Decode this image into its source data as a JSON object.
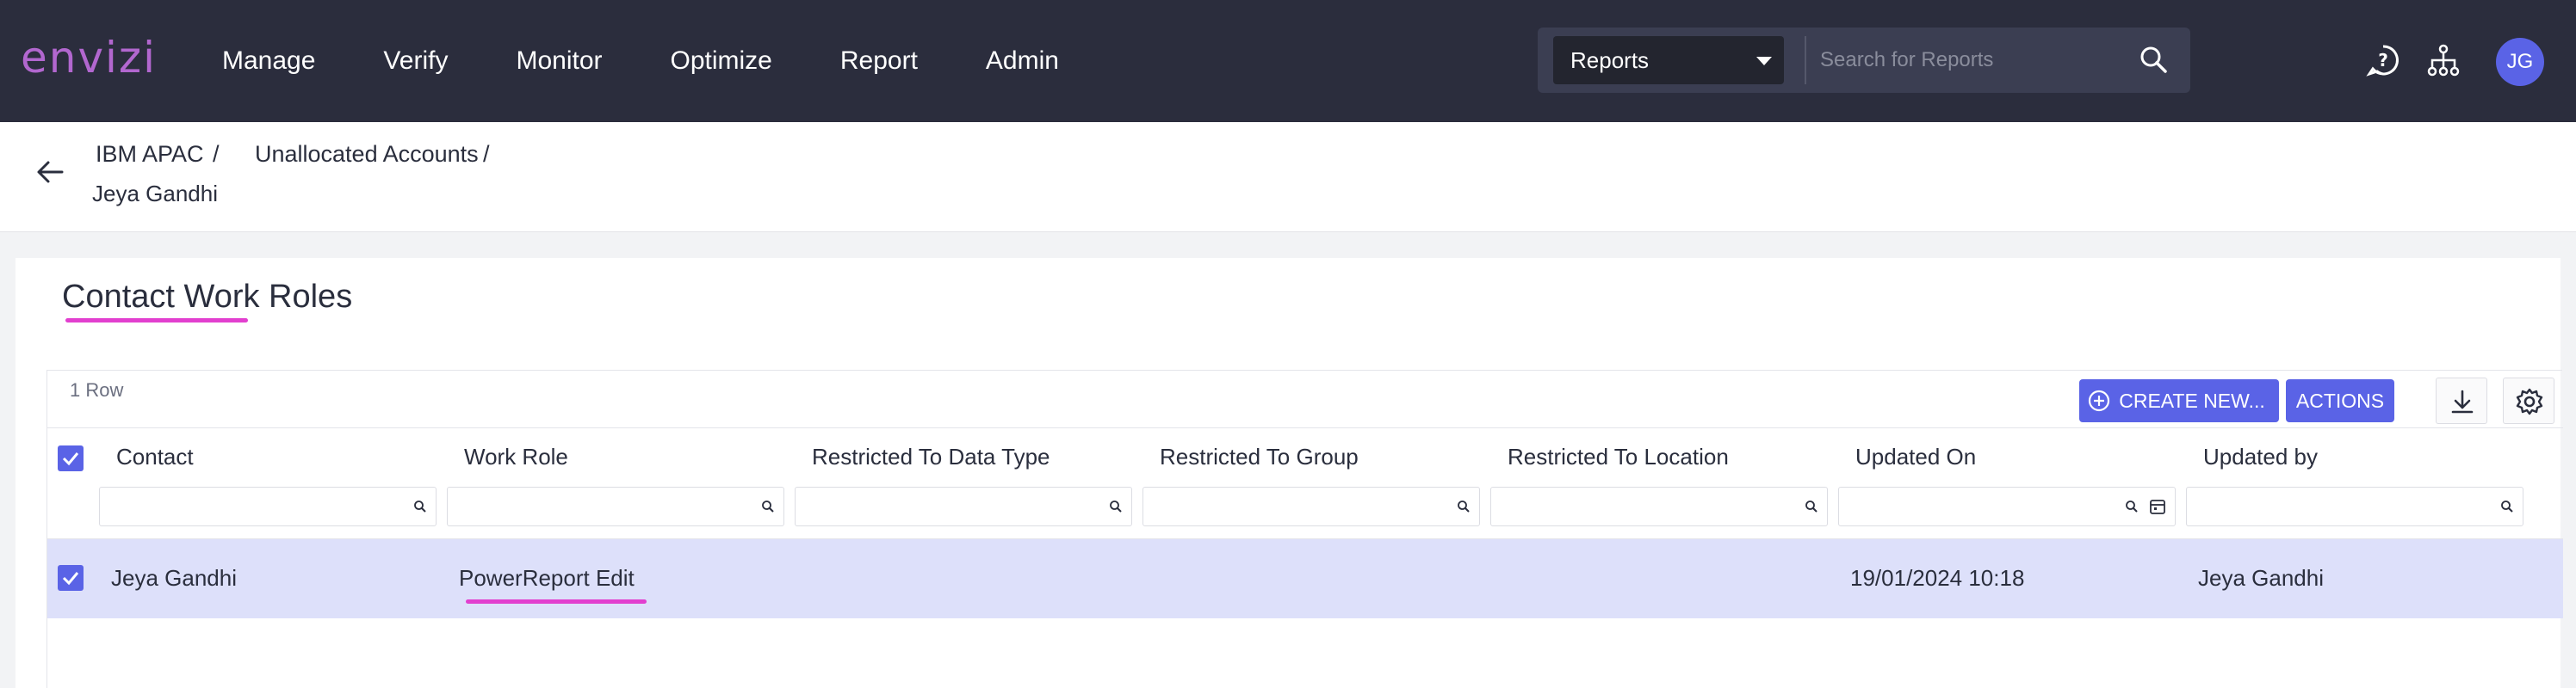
{
  "app": {
    "logo": "envizi"
  },
  "nav": [
    {
      "label": "Manage"
    },
    {
      "label": "Verify"
    },
    {
      "label": "Monitor"
    },
    {
      "label": "Optimize"
    },
    {
      "label": "Report"
    },
    {
      "label": "Admin"
    }
  ],
  "search": {
    "scope": "Reports",
    "placeholder": "Search for Reports"
  },
  "user": {
    "initials": "JG"
  },
  "breadcrumb": {
    "items": [
      "IBM APAC",
      "Unallocated Accounts"
    ],
    "separator": "/",
    "current": "Jeya Gandhi"
  },
  "page": {
    "title": "Contact Work Roles"
  },
  "grid": {
    "row_count": "1 Row",
    "create_label": "CREATE NEW...",
    "actions_label": "ACTIONS",
    "columns": [
      "Contact",
      "Work Role",
      "Restricted To Data Type",
      "Restricted To Group",
      "Restricted To Location",
      "Updated On",
      "Updated by"
    ],
    "rows": [
      {
        "contact": "Jeya Gandhi",
        "work_role": "PowerReport Edit",
        "data_type": "",
        "group": "",
        "location": "",
        "updated_on": "19/01/2024 10:18",
        "updated_by": "Jeya Gandhi"
      }
    ]
  },
  "colors": {
    "topbar": "#2b2d3d",
    "accent": "#5a63e6",
    "highlight_row": "#dde0fa",
    "annotation": "#e23fcf",
    "logo": "#b267cf"
  }
}
